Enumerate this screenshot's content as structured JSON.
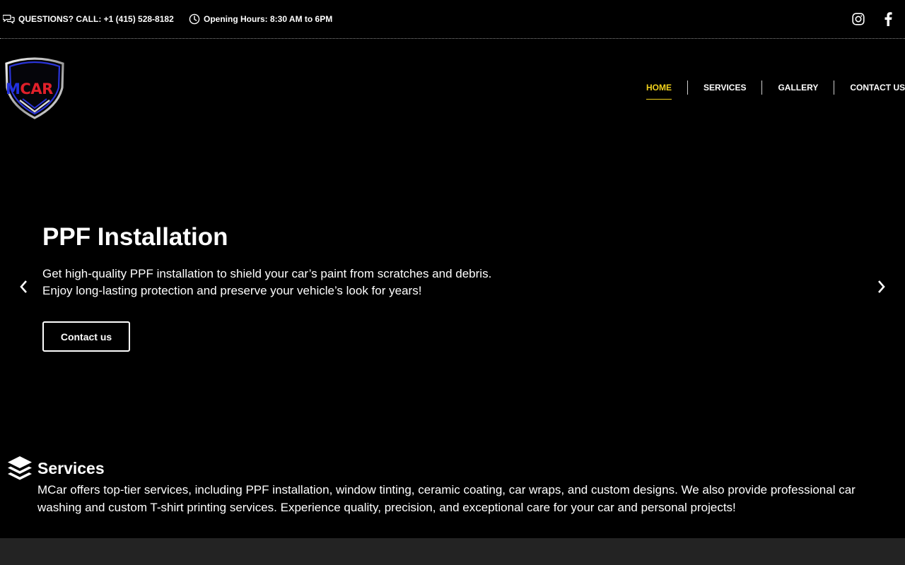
{
  "topbar": {
    "phone_text": "QUESTIONS? CALL: +1 (415) 528-8182",
    "phone_icon": "chat-bubbles-icon",
    "hours_text": "Opening Hours: 8:30 AM to 6PM",
    "hours_icon": "clock-icon",
    "social": [
      "instagram-icon",
      "facebook-icon"
    ]
  },
  "logo": {
    "text": "MCAR"
  },
  "nav": {
    "items": [
      {
        "label": "HOME",
        "active": true
      },
      {
        "label": "SERVICES"
      },
      {
        "label": "GALLERY"
      },
      {
        "label": "CONTACT US"
      }
    ],
    "active_color": "#f2d21b"
  },
  "hero": {
    "title": "PPF Installation",
    "description_line1": "Get high-quality PPF installation to shield your car’s paint from scratches and debris.",
    "description_line2": "Enjoy long-lasting protection and preserve your vehicle’s look for years!",
    "button_label": "Contact us"
  },
  "services": {
    "title": "Services",
    "icon": "layers-icon",
    "description": "MCar offers top-tier services, including PPF installation, window tinting, ceramic coating, car wraps, and custom designs. We also provide professional car washing and custom T-shirt printing services. Experience quality, precision, and exceptional care for your car and personal projects!"
  }
}
